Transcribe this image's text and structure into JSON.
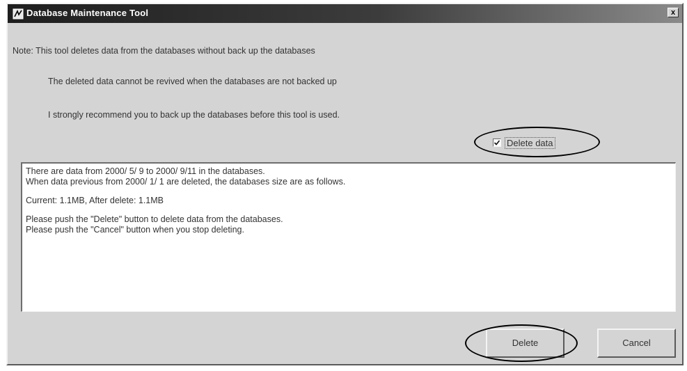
{
  "window": {
    "title": "Database Maintenance Tool",
    "close_glyph": "x"
  },
  "notes": [
    "Note: This tool deletes data from the databases without back up the databases",
    "The deleted data cannot be revived when the databases are not backed up",
    "I strongly recommend you to back up the databases before this tool is used."
  ],
  "delete_data_option": {
    "label": "Delete data",
    "checked": true
  },
  "info": {
    "line1": "There are data from 2000/ 5/ 9 to 2000/ 9/11 in the databases.",
    "line2": "When data previous from 2000/ 1/ 1 are deleted, the databases size are as follows.",
    "line3": "Current:  1.1MB,  After delete:  1.1MB",
    "line4": "Please push the \"Delete\" button to delete data from the databases.",
    "line5": "Please push the \"Cancel\" button when you stop deleting."
  },
  "buttons": {
    "delete_label": "Delete",
    "cancel_label": "Cancel"
  }
}
